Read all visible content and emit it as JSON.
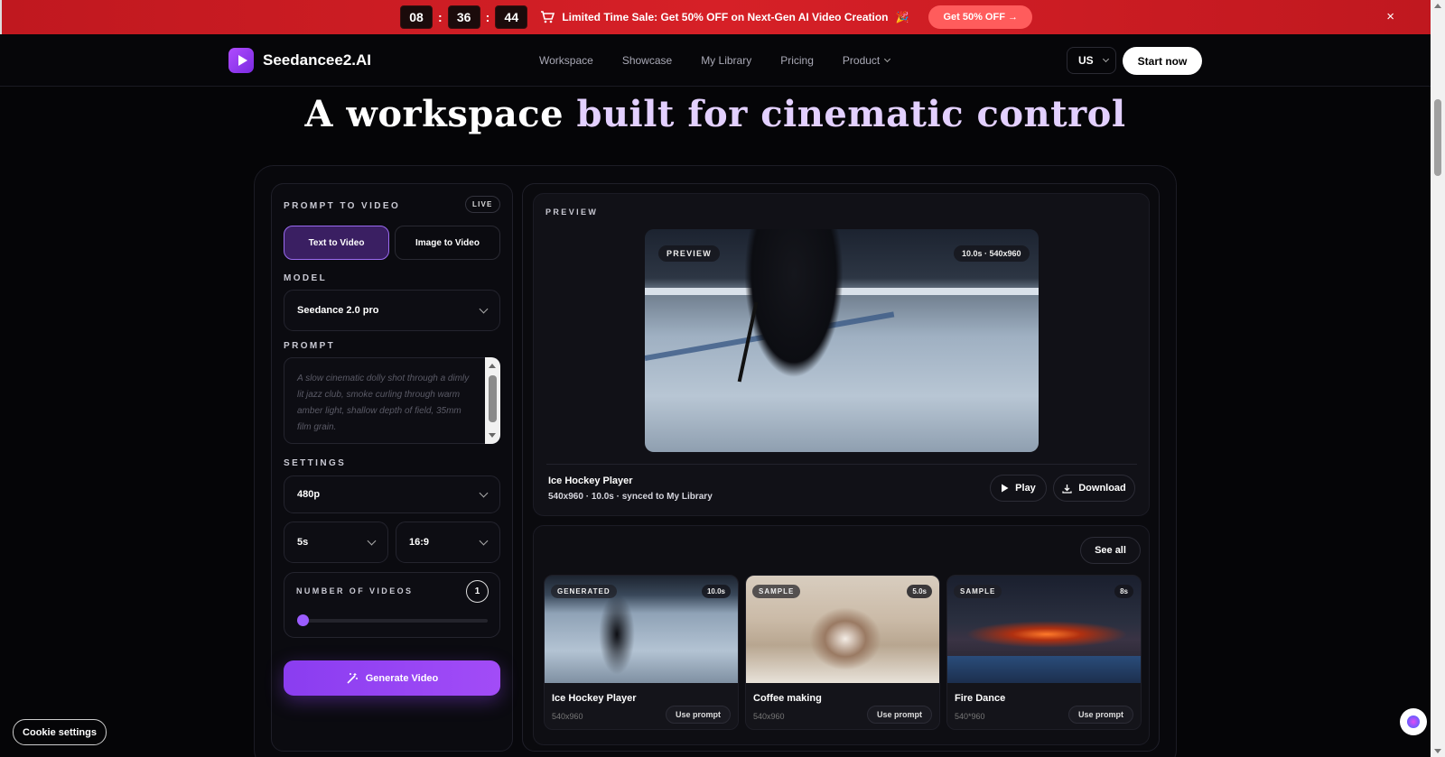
{
  "promo": {
    "timer": {
      "hours": "08",
      "minutes": "36",
      "seconds": "44",
      "separator": ":"
    },
    "text": "Limited Time Sale: Get 50% OFF on Next-Gen AI Video Creation",
    "cart_icon": "cart-icon",
    "emoji": "🎉",
    "button_label": "Get 50% OFF",
    "arrow": "→",
    "close": "×"
  },
  "nav": {
    "brand": "Seedancee2.AI",
    "links": [
      "Workspace",
      "Showcase",
      "My Library",
      "Pricing",
      "Product"
    ],
    "language": "US",
    "cta": "Start now"
  },
  "hero": {
    "title_part1": "A workspace ",
    "title_part2": "built for cinematic control"
  },
  "panel": {
    "section_label": "PROMPT TO VIDEO",
    "live_badge": "LIVE",
    "tabs": [
      "Text to Video",
      "Image to Video"
    ],
    "model_label": "MODEL",
    "model_value": "Seedance 2.0 pro",
    "prompt_label": "PROMPT",
    "prompt_placeholder": "A slow cinematic dolly shot through a dimly lit jazz club, smoke curling through warm amber light, shallow depth of field, 35mm film grain.",
    "settings_label": "SETTINGS",
    "resolution": "480p",
    "duration": "5s",
    "aspect": "16:9",
    "num_videos_label": "NUMBER OF VIDEOS",
    "num_videos": "1",
    "slider_fraction": 0.0,
    "generate_label": "Generate Video"
  },
  "preview": {
    "label": "PREVIEW",
    "overlay_tag": "PREVIEW",
    "overlay_meta": "10.0s · 540x960",
    "title": "Ice Hockey Player",
    "meta": "540x960 · 10.0s · synced to My Library",
    "play_label": "Play",
    "download_label": "Download"
  },
  "gallery": {
    "see_all": "See all",
    "cards": [
      {
        "tag": "GENERATED",
        "duration": "10.0s",
        "title": "Ice Hockey Player",
        "size": "540x960",
        "button": "Use prompt"
      },
      {
        "tag": "SAMPLE",
        "duration": "5.0s",
        "title": "Coffee making",
        "size": "540x960",
        "button": "Use prompt"
      },
      {
        "tag": "SAMPLE",
        "duration": "8s",
        "title": "Fire Dance",
        "size": "540*960",
        "button": "Use prompt"
      }
    ]
  },
  "cookie": {
    "label": "Cookie settings"
  },
  "colors": {
    "accent": "#9b5cff",
    "promo_red": "#d62027",
    "tab_active": "#3a1f62"
  }
}
